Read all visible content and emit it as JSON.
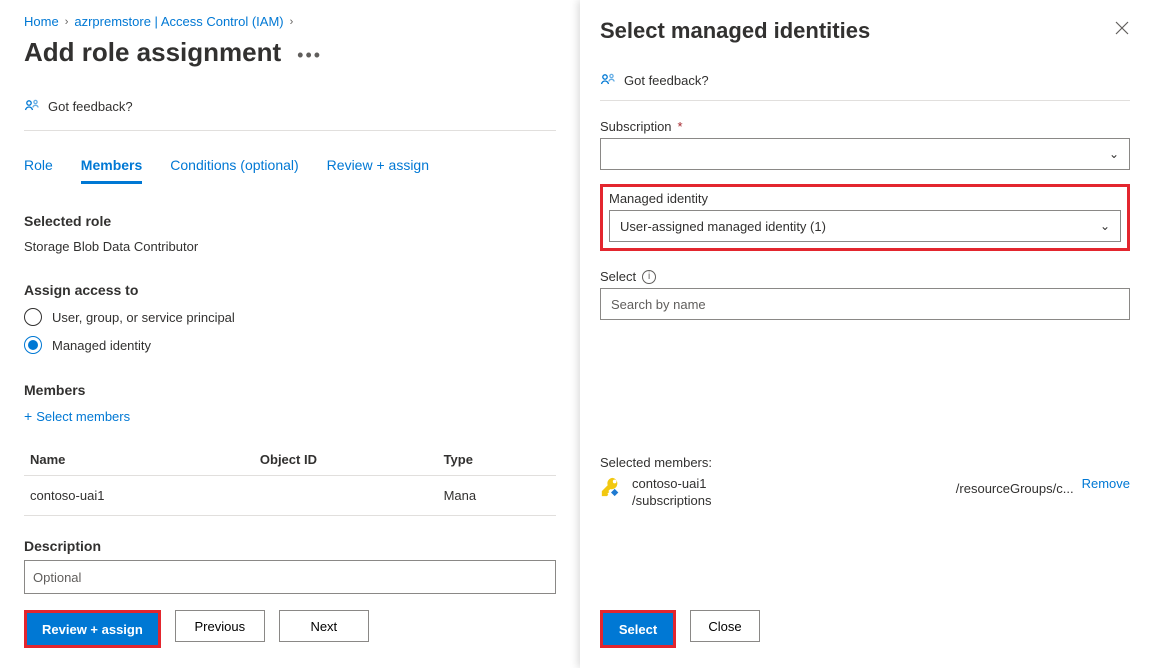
{
  "breadcrumbs": {
    "home": "Home",
    "resource": "azrpremstore | Access Control (IAM)"
  },
  "page": {
    "title": "Add role assignment",
    "feedback": "Got feedback?",
    "tabs": {
      "role": "Role",
      "members": "Members",
      "conditions": "Conditions (optional)",
      "review": "Review + assign"
    },
    "selected_role_label": "Selected role",
    "selected_role_value": "Storage Blob Data Contributor",
    "assign_access_label": "Assign access to",
    "radio_user": "User, group, or service principal",
    "radio_mi": "Managed identity",
    "members_label": "Members",
    "select_members": "Select members",
    "table": {
      "col_name": "Name",
      "col_object": "Object ID",
      "col_type": "Type",
      "rows": [
        {
          "name": "contoso-uai1",
          "object_id": "",
          "type": "Mana"
        }
      ]
    },
    "description_label": "Description",
    "description_placeholder": "Optional",
    "footer": {
      "review": "Review + assign",
      "previous": "Previous",
      "next": "Next"
    }
  },
  "panel": {
    "title": "Select managed identities",
    "feedback": "Got feedback?",
    "subscription_label": "Subscription",
    "mi_label": "Managed identity",
    "mi_value": "User-assigned managed identity (1)",
    "select_label": "Select",
    "search_placeholder": "Search by name",
    "selected_members_label": "Selected members:",
    "member": {
      "name": "contoso-uai1",
      "path_left": "/subscriptions",
      "path_right": "/resourceGroups/c...",
      "remove": "Remove"
    },
    "footer": {
      "select": "Select",
      "close": "Close"
    }
  }
}
